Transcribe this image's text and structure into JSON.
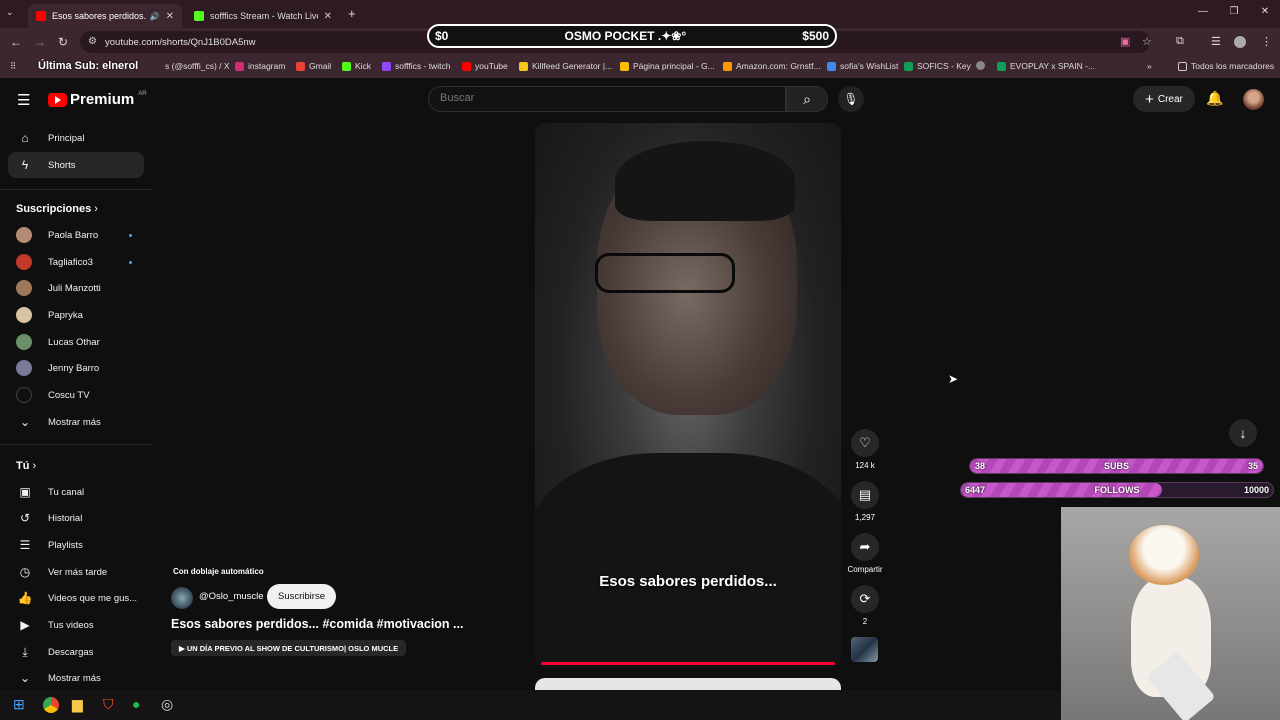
{
  "browser": {
    "tabs": [
      {
        "title": "Esos sabores perdidos... #c",
        "active": true,
        "favicon_color": "#ff0000"
      },
      {
        "title": "sofffics Stream - Watch Live on",
        "active": false,
        "favicon_color": "#53fc18"
      }
    ],
    "new_tab": "+",
    "url": "youtube.com/shorts/QnJ1B0DA5nw",
    "bookmarks": [
      {
        "label": "s (@sofffi_cs) / X",
        "color": "#444444"
      },
      {
        "label": "instagram",
        "color": "#d62976"
      },
      {
        "label": "Gmail",
        "color": "#ea4335"
      },
      {
        "label": "Kick",
        "color": "#53fc18"
      },
      {
        "label": "sofffics - twitch",
        "color": "#9146ff"
      },
      {
        "label": "youTube",
        "color": "#ff0000"
      },
      {
        "label": "Killfeed Generator |...",
        "color": "#f5c518"
      },
      {
        "label": "Página principal - G...",
        "color": "#fbbc04"
      },
      {
        "label": "Amazon.com: Grnstf...",
        "color": "#ff9900"
      },
      {
        "label": "sofia's WishList",
        "color": "#4285f4"
      },
      {
        "label": "SOFICS - Key",
        "color": "#0f9d58"
      },
      {
        "label": "",
        "color": "#888888"
      },
      {
        "label": "EVOPLAY x SPAIN -...",
        "color": "#0f9d58"
      }
    ],
    "bookmarks_more": "»",
    "all_bookmarks": "Todos los marcadores"
  },
  "overlay": {
    "goal_left": "$0",
    "goal_title": "OSMO POCKET .✦❀°",
    "goal_right": "$500",
    "last_sub": "Última Sub: elnerol",
    "subs_bar": {
      "left": "38",
      "label": "SUBS",
      "right": "35",
      "fill": 1.0
    },
    "follows_bar": {
      "left": "6447",
      "label": "FOLLOWS",
      "right": "10000",
      "fill": 0.6447
    }
  },
  "youtube": {
    "logo_text": "Premium",
    "logo_region": "AR",
    "search_placeholder": "Buscar",
    "create_label": "Crear",
    "sidebar": {
      "main": [
        {
          "label": "Principal",
          "icon": "⌂"
        },
        {
          "label": "Shorts",
          "icon": "ϟ",
          "active": true
        }
      ],
      "subscriptions_header": "Suscripciones",
      "subscriptions": [
        {
          "label": "Paola Barro",
          "dot": true,
          "color": "#b58a74"
        },
        {
          "label": "Tagliafico3",
          "dot": true,
          "color": "#c0392b"
        },
        {
          "label": "Juli Manzotti",
          "dot": false,
          "color": "#9c7a5b"
        },
        {
          "label": "Papryka",
          "dot": false,
          "color": "#d8c3a5"
        },
        {
          "label": "Lucas Othar",
          "dot": false,
          "color": "#6b8e6b"
        },
        {
          "label": "Jenny Barro",
          "dot": false,
          "color": "#7a7a9a"
        },
        {
          "label": "Coscu TV",
          "dot": false,
          "color": "#111111"
        }
      ],
      "show_more_subs": "Mostrar más",
      "you_header": "Tú",
      "you_items": [
        {
          "label": "Tu canal",
          "icon": "▣"
        },
        {
          "label": "Historial",
          "icon": "↺"
        },
        {
          "label": "Playlists",
          "icon": "☰"
        },
        {
          "label": "Ver más tarde",
          "icon": "◷"
        },
        {
          "label": "Videos que me gus...",
          "icon": "👍"
        },
        {
          "label": "Tus videos",
          "icon": "▶"
        },
        {
          "label": "Descargas",
          "icon": "⤓"
        }
      ],
      "show_more_you": "Mostrar más"
    },
    "short": {
      "caption": "Esos sabores perdidos...",
      "auto_dub": "Con doblaje automático",
      "channel": "@Oslo_muscle",
      "subscribe": "Suscribirse",
      "title": "Esos sabores perdidos... #comida #motivacion ...",
      "chip": "▶ UN DÍA PREVIO AL SHOW DE CULTURISMO| OSLO MUCLE",
      "likes": "124 k",
      "comments": "1,297",
      "share": "Compartir",
      "remix": "2"
    }
  }
}
